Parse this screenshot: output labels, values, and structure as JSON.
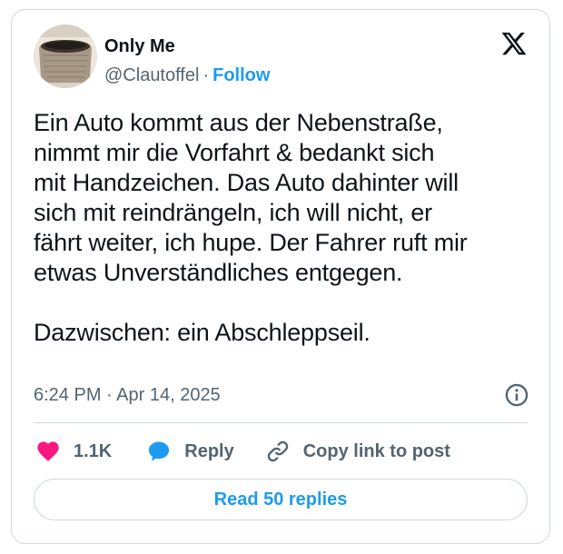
{
  "author": {
    "display_name": "Only Me",
    "handle": "@Clautoffel",
    "separator": "·",
    "follow_label": "Follow"
  },
  "tweet": {
    "text": "Ein Auto kommt aus der Nebenstraße,\nnimmt mir die Vorfahrt & bedankt sich\nmit Handzeichen. Das Auto dahinter will\nsich mit reindrängeln, ich will nicht, er\nfährt weiter, ich hupe. Der Fahrer ruft mir\netwas Unverständliches entgegen.\n\nDazwischen: ein Abschleppseil.",
    "timestamp": "6:24 PM · Apr 14, 2025"
  },
  "actions": {
    "like_count": "1.1K",
    "reply_label": "Reply",
    "copy_link_label": "Copy link to post"
  },
  "footer": {
    "read_replies_label": "Read 50 replies"
  },
  "icons": {
    "brand": "x-logo-icon",
    "info": "info-icon",
    "like": "heart-icon",
    "reply": "speech-bubble-icon",
    "copy": "link-icon"
  },
  "colors": {
    "like": "#f91880",
    "reply": "#1d9bf0",
    "link": "#1d9bf0",
    "text_primary": "#0f1419",
    "text_secondary": "#536471",
    "border": "#cfd9de"
  }
}
